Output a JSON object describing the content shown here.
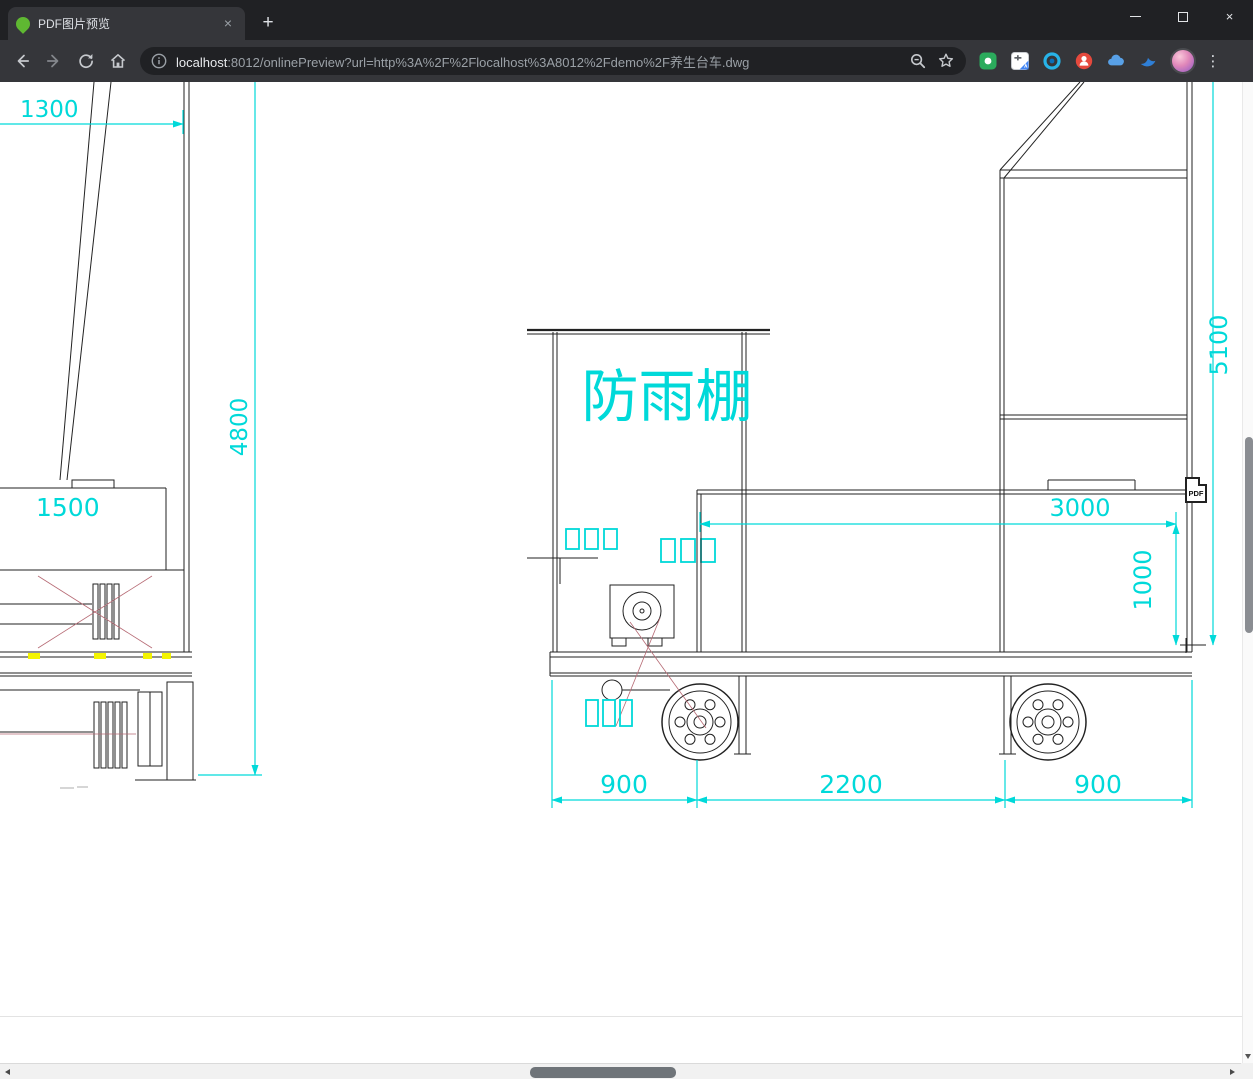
{
  "browser": {
    "tab_title": "PDF图片预览",
    "url_host": "localhost",
    "url_path": ":8012/onlinePreview?url=http%3A%2F%2Flocalhost%3A8012%2Fdemo%2F养生台车.dwg",
    "icons": {
      "new_tab": "+",
      "tab_close": "×",
      "window_close": "×",
      "menu_dots": "⋮"
    }
  },
  "drawing": {
    "shelter_label": "防雨棚",
    "pdf_badge_label": "PDF",
    "dimension_color": "#00d9d9",
    "dimensions": {
      "top_width": "1300",
      "mast_height": "4800",
      "left_width": "1500",
      "overall_height": "5100",
      "deck_length": "3000",
      "deck_height": "1000",
      "axle_left": "900",
      "axle_center": "2200",
      "axle_right": "900"
    }
  }
}
